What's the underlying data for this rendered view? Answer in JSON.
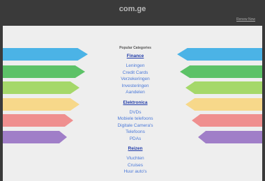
{
  "header": {
    "domain": "com.ge",
    "renew_label": "Renew Now"
  },
  "heading": "Popular Categories",
  "categories": [
    {
      "title": "Finance",
      "links": [
        "Leningen",
        "Credit Cards",
        "Verzekeringen",
        "Investeringen",
        "Aandelen"
      ]
    },
    {
      "title": "Elektronica",
      "links": [
        "DVDs",
        "Mobiele telefoons",
        "Digitale Camera's",
        "Telefoons",
        "PDAs"
      ]
    },
    {
      "title": "Reizen",
      "links": [
        "Vluchten",
        "Cruises",
        "Huur auto's"
      ]
    }
  ],
  "band_colors": [
    "#4bb3e6",
    "#5cc267",
    "#a5d86a",
    "#f7d88a",
    "#ef8f8f",
    "#a07ec8"
  ]
}
